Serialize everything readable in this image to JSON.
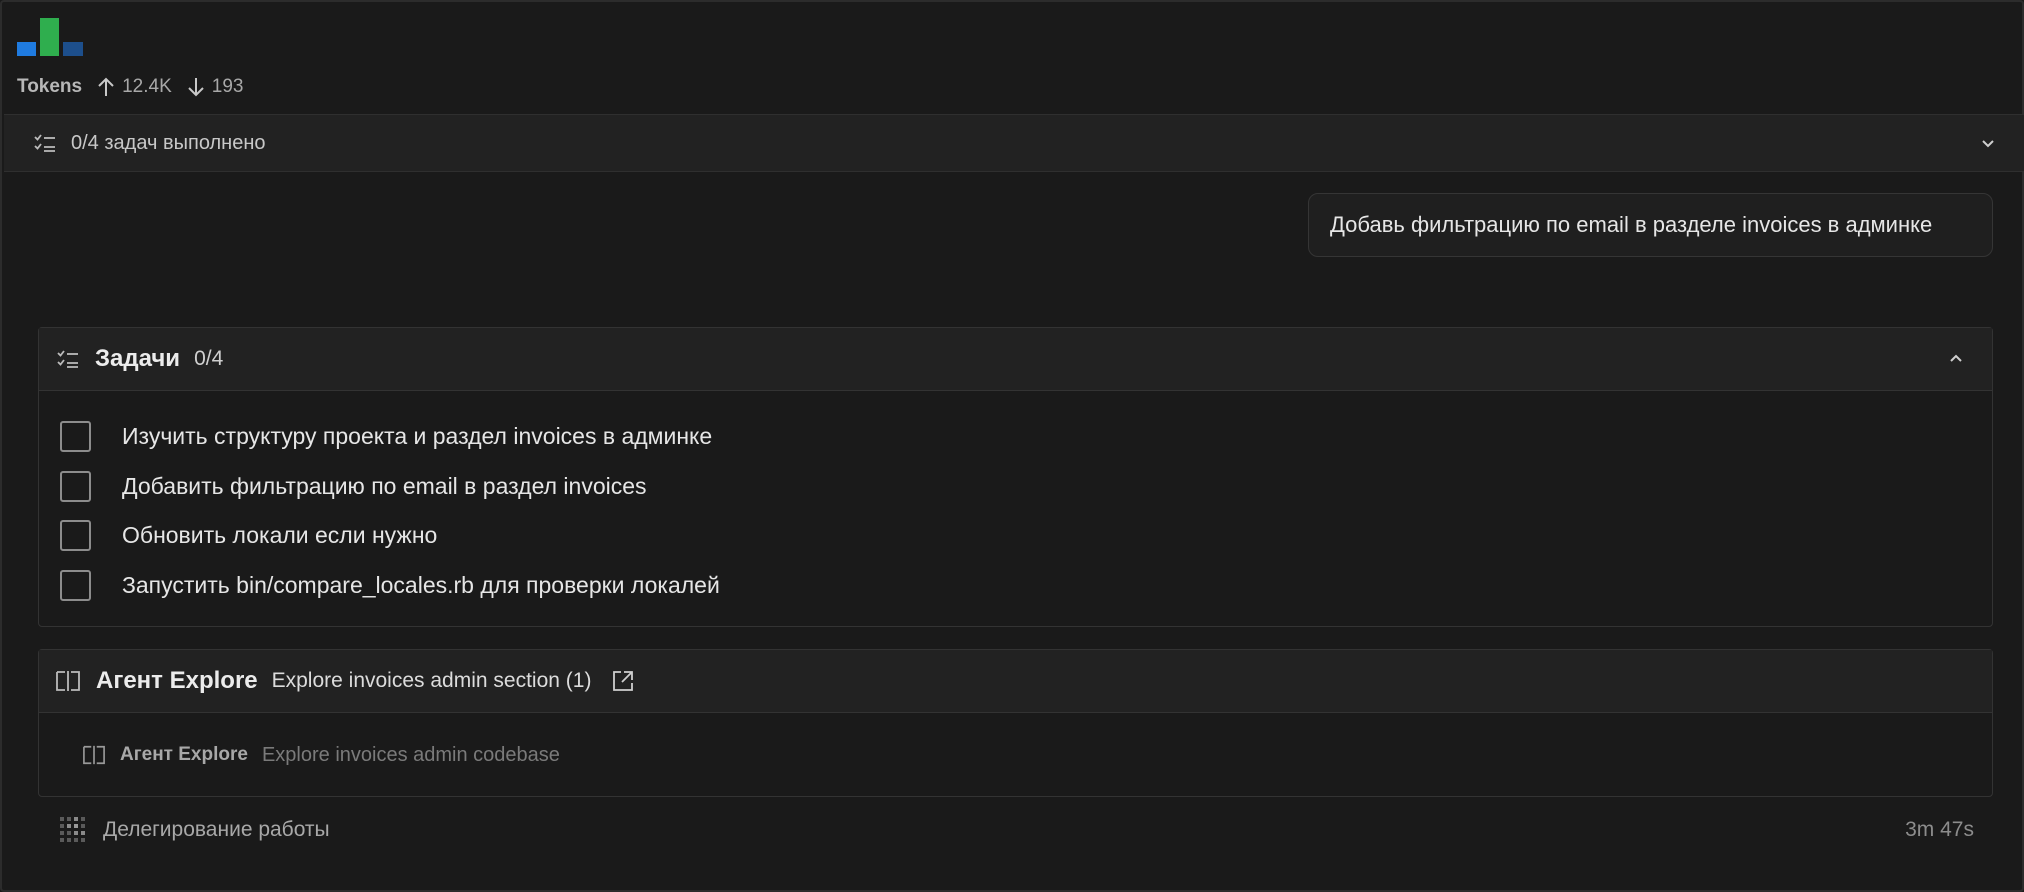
{
  "header": {
    "tokens_label": "Tokens",
    "tokens_up": "12.4K",
    "tokens_down": "193"
  },
  "progress": {
    "text": "0/4 задач выполнено"
  },
  "user_message": "Добавь фильтрацию по email в разделе invoices в админке",
  "tasks": {
    "title": "Задачи",
    "count": "0/4",
    "items": [
      {
        "label": "Изучить структуру проекта и раздел invoices в админке",
        "done": false
      },
      {
        "label": "Добавить фильтрацию по email в раздел invoices",
        "done": false
      },
      {
        "label": "Обновить локали если нужно",
        "done": false
      },
      {
        "label": "Запустить bin/compare_locales.rb для проверки локалей",
        "done": false
      }
    ]
  },
  "agent": {
    "title": "Агент Explore",
    "description": "Explore invoices admin section (1)",
    "sub_title": "Агент Explore",
    "sub_description": "Explore invoices admin codebase"
  },
  "footer": {
    "status": "Делегирование работы",
    "elapsed": "3m 47s"
  },
  "colors": {
    "background": "#1a1a1a",
    "panel_header": "#222222",
    "border": "#333333",
    "logo_blue": "#1f7be0",
    "logo_green": "#2fae4e",
    "logo_dark_blue": "#1d4f8c"
  }
}
